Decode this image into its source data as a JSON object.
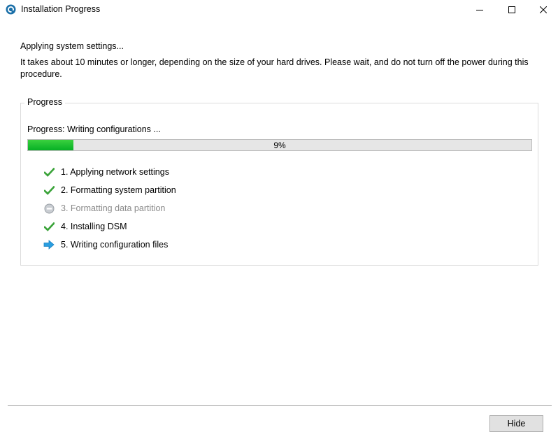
{
  "window": {
    "title": "Installation Progress",
    "app_icon": "synology-assistant-icon"
  },
  "main": {
    "heading": "Applying system settings...",
    "description": "It takes about 10 minutes or longer, depending on the size of your hard drives. Please wait, and do not turn off the power during this procedure."
  },
  "progress_group": {
    "title": "Progress",
    "status_label": "Progress: Writing configurations ...",
    "percent_text": "9%",
    "percent_value": 9,
    "fill_color": "#06b025",
    "steps": [
      {
        "label": "1. Applying network settings",
        "status": "done",
        "icon": "check-icon"
      },
      {
        "label": "2. Formatting system partition",
        "status": "done",
        "icon": "check-icon"
      },
      {
        "label": "3. Formatting data partition",
        "status": "skipped",
        "icon": "minus-circle-icon"
      },
      {
        "label": "4. Installing DSM",
        "status": "done",
        "icon": "check-icon"
      },
      {
        "label": "5. Writing configuration files",
        "status": "in-progress",
        "icon": "arrow-right-icon"
      }
    ]
  },
  "footer": {
    "hide_label": "Hide"
  }
}
